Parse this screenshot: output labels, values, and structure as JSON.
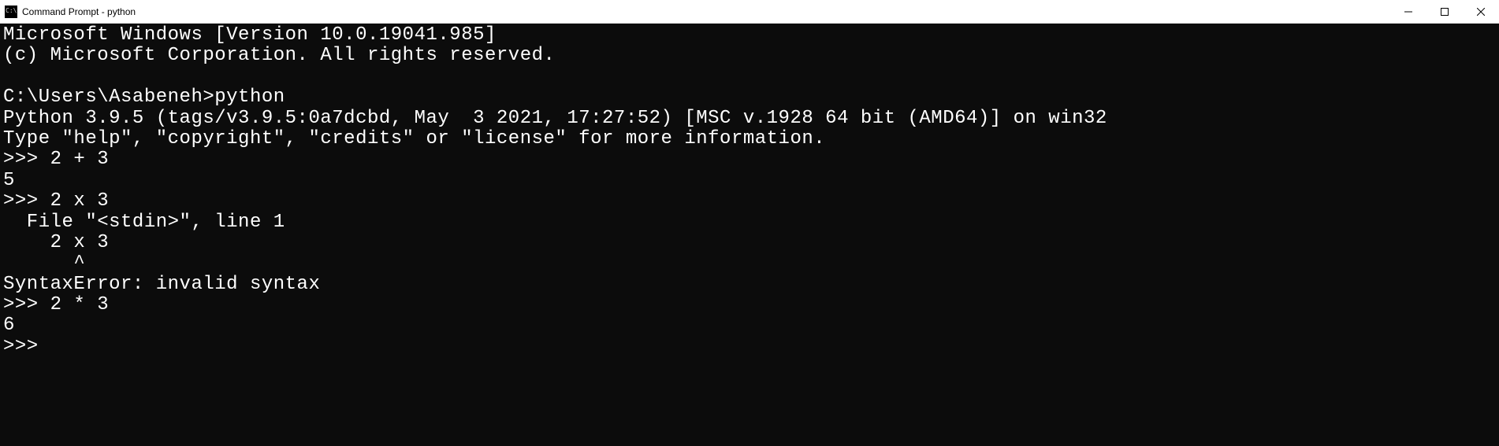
{
  "titlebar": {
    "title": "Command Prompt - python"
  },
  "terminal": {
    "lines": [
      "Microsoft Windows [Version 10.0.19041.985]",
      "(c) Microsoft Corporation. All rights reserved.",
      "",
      "C:\\Users\\Asabeneh>python",
      "Python 3.9.5 (tags/v3.9.5:0a7dcbd, May  3 2021, 17:27:52) [MSC v.1928 64 bit (AMD64)] on win32",
      "Type \"help\", \"copyright\", \"credits\" or \"license\" for more information.",
      ">>> 2 + 3",
      "5",
      ">>> 2 x 3",
      "  File \"<stdin>\", line 1",
      "    2 x 3",
      "      ^",
      "SyntaxError: invalid syntax",
      ">>> 2 * 3",
      "6",
      ">>>"
    ]
  }
}
